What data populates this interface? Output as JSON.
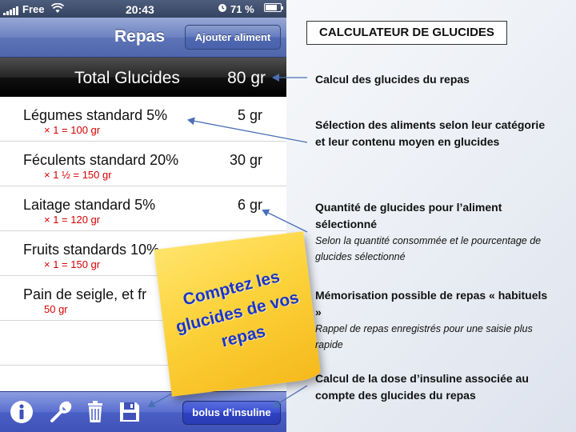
{
  "status_bar": {
    "carrier": "Free",
    "time": "20:43",
    "battery": "71 %"
  },
  "nav": {
    "title": "Repas",
    "add_button": "Ajouter aliment"
  },
  "total": {
    "label": "Total Glucides",
    "value": "80 gr"
  },
  "items": [
    {
      "name": "Légumes standard 5%",
      "qty": "× 1 = 100 gr",
      "value": "5 gr"
    },
    {
      "name": "Féculents standard 20%",
      "qty": "× 1 ½ = 150 gr",
      "value": "30 gr"
    },
    {
      "name": "Laitage standard 5%",
      "qty": "× 1 = 120 gr",
      "value": "6 gr"
    },
    {
      "name": "Fruits standards 10%",
      "qty": "× 1 = 150 gr",
      "value": ""
    },
    {
      "name": "Pain de seigle, et fr",
      "qty": "50 gr",
      "value": ""
    }
  ],
  "toolbar": {
    "icons": [
      "info-icon",
      "wrench-icon",
      "trash-icon",
      "save-icon"
    ],
    "bolus_button": "bolus d'insuline"
  },
  "sticky_note": {
    "line1": "Comptez les",
    "line2": "glucides de vos",
    "line3": "repas"
  },
  "slide": {
    "title": "CALCULATEUR DE GLUCIDES",
    "annotations": [
      {
        "heading": "Calcul des glucides du repas",
        "sub": ""
      },
      {
        "heading": "Sélection des aliments selon leur catégorie et leur contenu moyen en glucides",
        "sub": ""
      },
      {
        "heading": "Quantité de glucides pour l’aliment sélectionné",
        "sub": "Selon la quantité consommée et le pourcentage de glucides sélectionné"
      },
      {
        "heading": "Mémorisation possible de repas « habituels »",
        "sub": "Rappel de repas enregistrés pour une saisie plus rapide"
      },
      {
        "heading": "Calcul de la dose d’insuline associée au compte des glucides du repas",
        "sub": ""
      }
    ]
  },
  "colors": {
    "nav_blue": "#5d74b8",
    "toolbar_blue": "#4a5fc5",
    "qty_red": "#d50000",
    "sticky_yellow": "#fcd23a",
    "sticky_text": "#1a35c9",
    "arrow_blue": "#4a6fb5"
  }
}
